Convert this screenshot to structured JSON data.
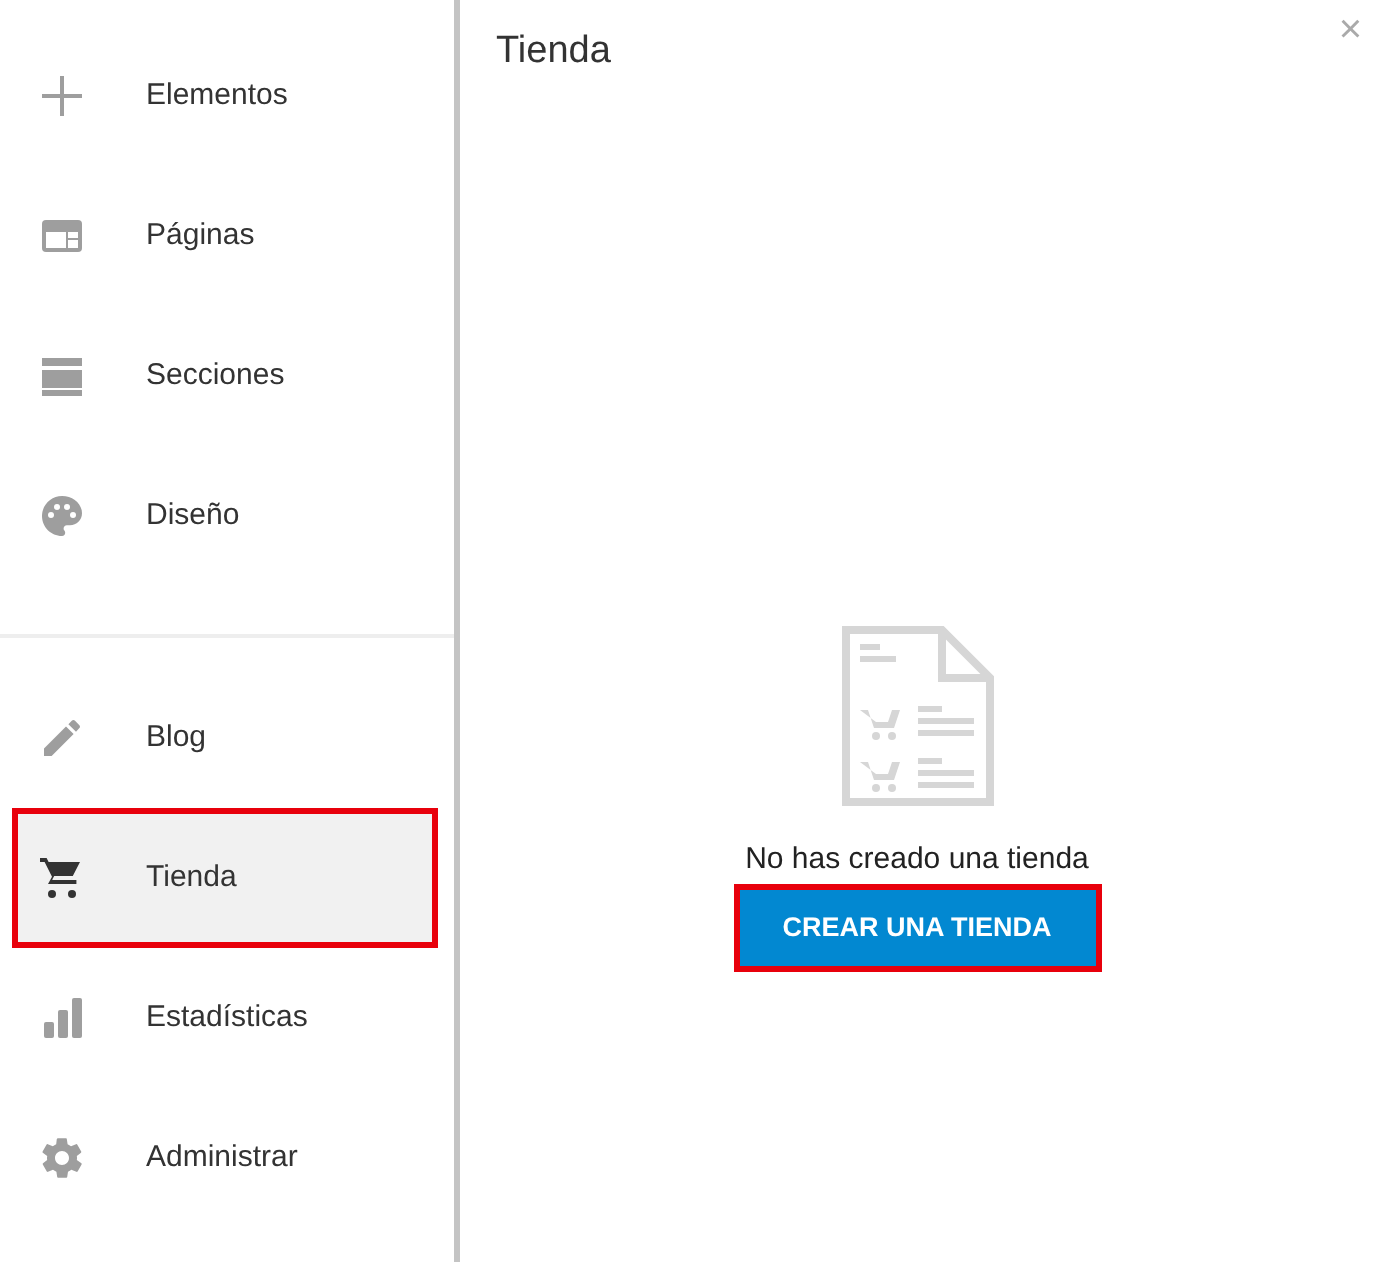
{
  "sidebar": {
    "groups": [
      {
        "items": [
          {
            "kind": "plus",
            "label": "Elementos",
            "selected": false
          },
          {
            "kind": "pages",
            "label": "Páginas",
            "selected": false
          },
          {
            "kind": "sections",
            "label": "Secciones",
            "selected": false
          },
          {
            "kind": "palette",
            "label": "Diseño",
            "selected": false
          }
        ]
      },
      {
        "items": [
          {
            "kind": "pencil",
            "label": "Blog",
            "selected": false
          },
          {
            "kind": "cart",
            "label": "Tienda",
            "selected": true
          },
          {
            "kind": "bars",
            "label": "Estadísticas",
            "selected": false
          },
          {
            "kind": "gear",
            "label": "Administrar",
            "selected": false
          }
        ]
      }
    ]
  },
  "panel": {
    "title": "Tienda",
    "close": "×",
    "empty_message": "No has creado una tienda",
    "button": {
      "label": "CREAR UNA TIENDA",
      "highlighted": true
    }
  }
}
